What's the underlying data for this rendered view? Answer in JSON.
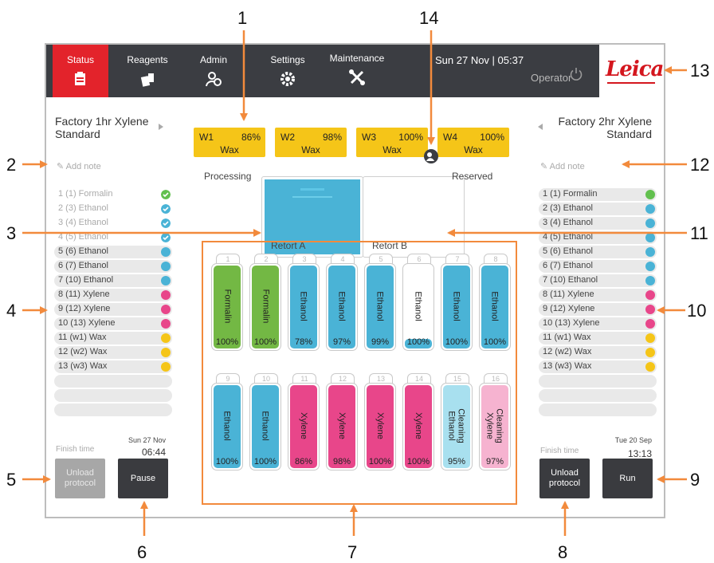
{
  "callouts": [
    "1",
    "2",
    "3",
    "4",
    "5",
    "6",
    "7",
    "8",
    "9",
    "10",
    "11",
    "12",
    "13",
    "14"
  ],
  "nav": {
    "tabs": [
      {
        "label": "Status",
        "icon": "status-icon"
      },
      {
        "label": "Reagents",
        "icon": "reagents-icon"
      },
      {
        "label": "Admin",
        "icon": "admin-icon"
      },
      {
        "label": "Settings",
        "icon": "gear-icon"
      },
      {
        "label": "Maintenance",
        "icon": "maintenance-icon"
      }
    ],
    "datetime": "Sun 27 Nov | 05:37",
    "user": "Operator",
    "logo": "Leica"
  },
  "colors": {
    "accent": "#e3232b",
    "nav": "#3b3d42",
    "formalin": "#73b844",
    "ethanol": "#4ab3d6",
    "xylene": "#e8468a",
    "wax": "#f5c518",
    "cleaning_ethanol": "#a8e0ef",
    "cleaning_xylene": "#f6b3d0",
    "complete": "#62c04e"
  },
  "left_panel": {
    "protocol_line1": "Factory 1hr Xylene",
    "protocol_line2": "Standard",
    "note": "Add note",
    "steps": [
      {
        "label": "1  (1) Formalin",
        "dot": "#62c04e",
        "done": true
      },
      {
        "label": "2  (3) Ethanol",
        "dot": "#4ab3d6",
        "done": true
      },
      {
        "label": "3  (4) Ethanol",
        "dot": "#4ab3d6",
        "done": true
      },
      {
        "label": "4  (5) Ethanol",
        "dot": "#4ab3d6",
        "done": true
      },
      {
        "label": "5  (6) Ethanol",
        "dot": "#4ab3d6",
        "done": false
      },
      {
        "label": "6  (7) Ethanol",
        "dot": "#4ab3d6",
        "done": false
      },
      {
        "label": "7  (10) Ethanol",
        "dot": "#4ab3d6",
        "done": false
      },
      {
        "label": "8  (11) Xylene",
        "dot": "#e8468a",
        "done": false
      },
      {
        "label": "9  (12) Xylene",
        "dot": "#e8468a",
        "done": false
      },
      {
        "label": "10  (13) Xylene",
        "dot": "#e8468a",
        "done": false
      },
      {
        "label": "11  (w1) Wax",
        "dot": "#f5c518",
        "done": false
      },
      {
        "label": "12  (w2) Wax",
        "dot": "#f5c518",
        "done": false
      },
      {
        "label": "13  (w3) Wax",
        "dot": "#f5c518",
        "done": false
      }
    ],
    "finish_label": "Finish time",
    "finish_date": "Sun 27 Nov",
    "finish_time": "06:44",
    "unload_line1": "Unload",
    "unload_line2": "protocol",
    "pause": "Pause"
  },
  "right_panel": {
    "protocol_line1": "Factory 2hr Xylene",
    "protocol_line2": "Standard",
    "note": "Add note",
    "steps": [
      {
        "label": "1  (1) Formalin",
        "dot": "#62c04e"
      },
      {
        "label": "2  (3) Ethanol",
        "dot": "#4ab3d6"
      },
      {
        "label": "3  (4) Ethanol",
        "dot": "#4ab3d6"
      },
      {
        "label": "4  (5) Ethanol",
        "dot": "#4ab3d6"
      },
      {
        "label": "5  (6) Ethanol",
        "dot": "#4ab3d6"
      },
      {
        "label": "6  (7) Ethanol",
        "dot": "#4ab3d6"
      },
      {
        "label": "7  (10) Ethanol",
        "dot": "#4ab3d6"
      },
      {
        "label": "8  (11) Xylene",
        "dot": "#e8468a"
      },
      {
        "label": "9  (12) Xylene",
        "dot": "#e8468a"
      },
      {
        "label": "10  (13) Xylene",
        "dot": "#e8468a"
      },
      {
        "label": "11  (w1) Wax",
        "dot": "#f5c518"
      },
      {
        "label": "12  (w2) Wax",
        "dot": "#f5c518"
      },
      {
        "label": "13  (w3) Wax",
        "dot": "#f5c518"
      }
    ],
    "finish_label": "Finish time",
    "finish_date": "Tue 20 Sep",
    "finish_time": "13:13",
    "unload_line1": "Unload",
    "unload_line2": "protocol",
    "run": "Run"
  },
  "wax_baths": [
    {
      "id": "W1",
      "pct": "86%",
      "name": "Wax"
    },
    {
      "id": "W2",
      "pct": "98%",
      "name": "Wax"
    },
    {
      "id": "W3",
      "pct": "100%",
      "name": "Wax"
    },
    {
      "id": "W4",
      "pct": "100%",
      "name": "Wax"
    }
  ],
  "retorts": {
    "a_status": "Processing",
    "a_name": "Retort A",
    "b_status": "Reserved",
    "b_name": "Retort B"
  },
  "bottles": [
    {
      "num": "1",
      "name": "Formalin",
      "pct": "100%",
      "fill": 1.0,
      "color": "#73b844"
    },
    {
      "num": "2",
      "name": "Formalin",
      "pct": "100%",
      "fill": 1.0,
      "color": "#73b844"
    },
    {
      "num": "3",
      "name": "Ethanol",
      "pct": "78%",
      "fill": 1.0,
      "color": "#4ab3d6"
    },
    {
      "num": "4",
      "name": "Ethanol",
      "pct": "97%",
      "fill": 1.0,
      "color": "#4ab3d6"
    },
    {
      "num": "5",
      "name": "Ethanol",
      "pct": "99%",
      "fill": 1.0,
      "color": "#4ab3d6"
    },
    {
      "num": "6",
      "name": "Ethanol",
      "pct": "100%",
      "fill": 0.12,
      "color": "#4ab3d6"
    },
    {
      "num": "7",
      "name": "Ethanol",
      "pct": "100%",
      "fill": 1.0,
      "color": "#4ab3d6"
    },
    {
      "num": "8",
      "name": "Ethanol",
      "pct": "100%",
      "fill": 1.0,
      "color": "#4ab3d6"
    },
    {
      "num": "9",
      "name": "Ethanol",
      "pct": "100%",
      "fill": 1.0,
      "color": "#4ab3d6"
    },
    {
      "num": "10",
      "name": "Ethanol",
      "pct": "100%",
      "fill": 1.0,
      "color": "#4ab3d6"
    },
    {
      "num": "11",
      "name": "Xylene",
      "pct": "86%",
      "fill": 1.0,
      "color": "#e8468a"
    },
    {
      "num": "12",
      "name": "Xylene",
      "pct": "98%",
      "fill": 1.0,
      "color": "#e8468a"
    },
    {
      "num": "13",
      "name": "Xylene",
      "pct": "100%",
      "fill": 1.0,
      "color": "#e8468a"
    },
    {
      "num": "14",
      "name": "Xylene",
      "pct": "100%",
      "fill": 1.0,
      "color": "#e8468a"
    },
    {
      "num": "15",
      "name": "Cleaning Ethanol",
      "pct": "95%",
      "fill": 1.0,
      "color": "#a8e0ef"
    },
    {
      "num": "16",
      "name": "Cleaning Xylene",
      "pct": "97%",
      "fill": 1.0,
      "color": "#f6b3d0"
    }
  ]
}
